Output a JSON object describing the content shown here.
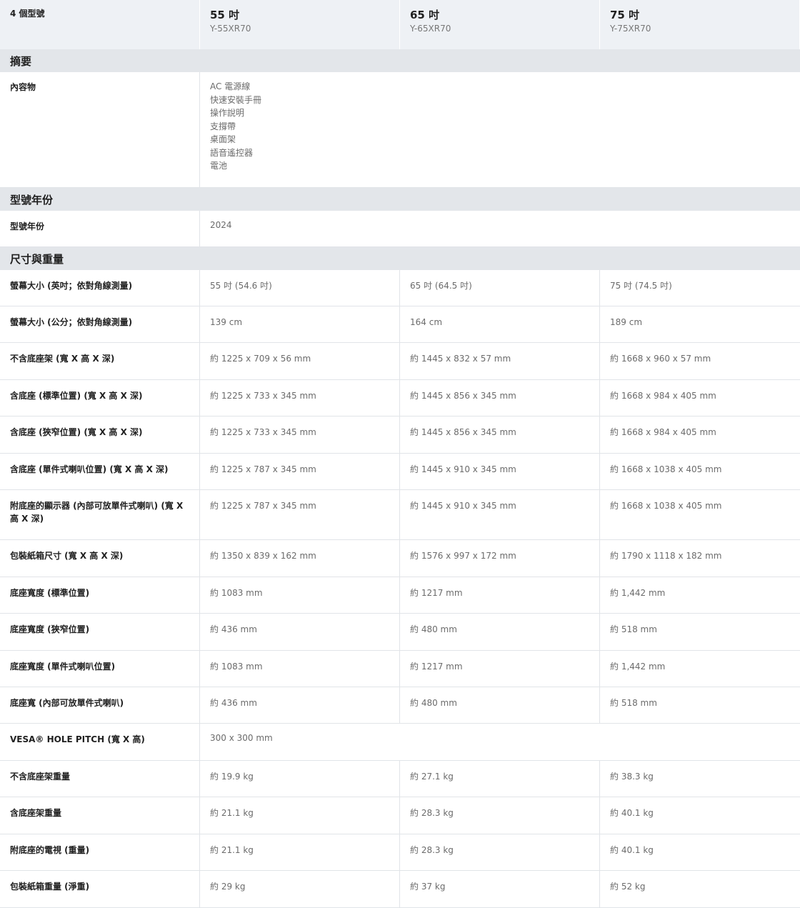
{
  "header": {
    "model_count": "4 個型號",
    "models": [
      {
        "size": "55 吋",
        "code": "Y-55XR70"
      },
      {
        "size": "65 吋",
        "code": "Y-65XR70"
      },
      {
        "size": "75 吋",
        "code": "Y-75XR70"
      }
    ]
  },
  "summary": {
    "title": "摘要",
    "contents_label": "內容物",
    "contents": [
      "AC 電源線",
      "快速安裝手冊",
      "操作說明",
      "支撐帶",
      "桌面架",
      "語音遙控器",
      "電池"
    ]
  },
  "model_year": {
    "title": "型號年份",
    "label": "型號年份",
    "value": "2024"
  },
  "dimensions": {
    "title": "尺寸與重量",
    "rows": [
      {
        "label": "螢幕大小 (英吋；依對角線測量)",
        "values": [
          "55 吋 (54.6 吋)",
          "65 吋 (64.5 吋)",
          "75 吋 (74.5 吋)"
        ]
      },
      {
        "label": "螢幕大小 (公分；依對角線測量)",
        "values": [
          "139 cm",
          "164 cm",
          "189 cm"
        ]
      },
      {
        "label": "不含底座架 (寬 X 高 X 深)",
        "values": [
          "約 1225 x 709 x 56 mm",
          "約 1445 x 832 x 57 mm",
          "約 1668 x 960 x 57 mm"
        ]
      },
      {
        "label": "含底座 (標準位置) (寬 X 高 X 深)",
        "values": [
          "約 1225 x 733 x 345 mm",
          "約 1445 x 856 x 345 mm",
          "約 1668 x 984 x 405 mm"
        ]
      },
      {
        "label": "含底座 (狹窄位置) (寬 X 高 X 深)",
        "values": [
          "約 1225 x 733 x 345 mm",
          "約 1445 x 856 x 345 mm",
          "約 1668 x 984 x 405 mm"
        ]
      },
      {
        "label": "含底座 (單件式喇叭位置) (寬 X 高 X 深)",
        "values": [
          "約 1225 x 787 x 345 mm",
          "約 1445 x 910 x 345 mm",
          "約 1668 x 1038 x 405 mm"
        ]
      },
      {
        "label": "附底座的顯示器 (內部可放單件式喇叭) (寬 X 高 X 深)",
        "values": [
          "約 1225 x 787 x 345 mm",
          "約 1445 x 910 x 345 mm",
          "約 1668 x 1038 x 405 mm"
        ]
      },
      {
        "label": "包裝紙箱尺寸 (寬 X 高 X 深)",
        "values": [
          "約 1350 x 839 x 162 mm",
          "約 1576 x 997 x 172 mm",
          "約 1790 x 1118 x 182 mm"
        ]
      },
      {
        "label": "底座寬度 (標準位置)",
        "values": [
          "約 1083 mm",
          "約 1217 mm",
          "約 1,442 mm"
        ]
      },
      {
        "label": "底座寬度 (狹窄位置)",
        "values": [
          "約 436 mm",
          "約 480 mm",
          "約 518 mm"
        ]
      },
      {
        "label": "底座寬度 (單件式喇叭位置)",
        "values": [
          "約 1083 mm",
          "約 1217 mm",
          "約 1,442 mm"
        ]
      },
      {
        "label": "底座寬 (內部可放單件式喇叭)",
        "values": [
          "約 436 mm",
          "約 480 mm",
          "約 518 mm"
        ]
      }
    ],
    "vesa": {
      "label": "VESA® HOLE PITCH (寬 X 高)",
      "value": "300 x 300 mm"
    },
    "weight_rows": [
      {
        "label": "不含底座架重量",
        "values": [
          "約 19.9 kg",
          "約 27.1 kg",
          "約 38.3 kg"
        ]
      },
      {
        "label": "含底座架重量",
        "values": [
          "約 21.1 kg",
          "約 28.3 kg",
          "約 40.1 kg"
        ]
      },
      {
        "label": "附底座的電視 (重量)",
        "values": [
          "約 21.1 kg",
          "約 28.3 kg",
          "約 40.1 kg"
        ]
      },
      {
        "label": "包裝紙箱重量 (淨重)",
        "values": [
          "約 29 kg",
          "約 37 kg",
          "約 52 kg"
        ]
      }
    ]
  }
}
